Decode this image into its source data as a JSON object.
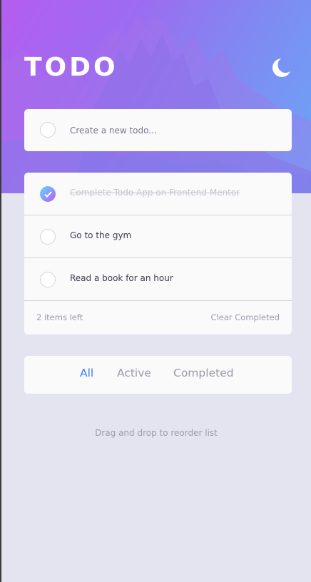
{
  "header": {
    "title": "TODO",
    "theme_icon": "moon-icon"
  },
  "new_todo": {
    "placeholder": "Create a new todo..."
  },
  "todos": [
    {
      "label": "Complete Todo App on Frontend Mentor",
      "completed": true
    },
    {
      "label": "Go to the gym",
      "completed": false
    },
    {
      "label": "Read a book for an hour",
      "completed": false
    }
  ],
  "footer": {
    "items_left": "2 items left",
    "clear_label": "Clear Completed"
  },
  "filters": {
    "all": "All",
    "active": "Active",
    "completed": "Completed",
    "selected": "All"
  },
  "hint": "Drag and drop to reorder list",
  "colors": {
    "accent": "#3a7bfd",
    "check_gradient_start": "#57ddff",
    "check_gradient_end": "#c058f3"
  }
}
